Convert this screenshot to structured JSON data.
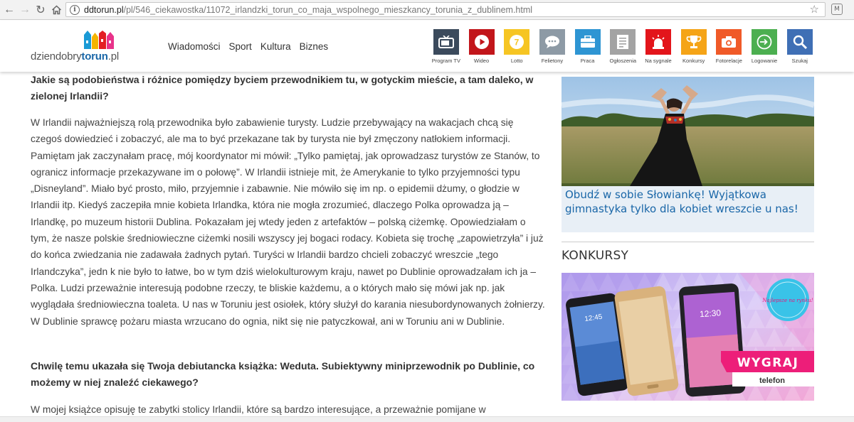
{
  "browser": {
    "url_host": "ddtorun.pl",
    "url_path": "/pl/546_ciekawostka/11072_irlandzki_torun_co_maja_wspolnego_mieszkancy_torunia_z_dublinem.html"
  },
  "header": {
    "logo_prefix": "dzien",
    "logo_mid": "dobry",
    "logo_bold": "torun",
    "logo_suffix": ".pl",
    "nav": [
      "Wiadomości",
      "Sport",
      "Kultura",
      "Biznes"
    ],
    "tiles": [
      {
        "label": "Program TV",
        "color": "#3b4a5c",
        "icon": "tv-icon"
      },
      {
        "label": "Wideo",
        "color": "#c2161b",
        "icon": "play-icon"
      },
      {
        "label": "Lotto",
        "color": "#f6c523",
        "icon": "lotto-ball-icon"
      },
      {
        "label": "Felietony",
        "color": "#8d9aa5",
        "icon": "speech-bubble-icon"
      },
      {
        "label": "Praca",
        "color": "#2e95d3",
        "icon": "briefcase-icon"
      },
      {
        "label": "Ogłoszenia",
        "color": "#a3a3a3",
        "icon": "document-icon"
      },
      {
        "label": "Na sygnale",
        "color": "#e3151b",
        "icon": "siren-icon"
      },
      {
        "label": "Konkursy",
        "color": "#f5a417",
        "icon": "trophy-icon"
      },
      {
        "label": "Fotorelacje",
        "color": "#f05a28",
        "icon": "camera-icon"
      },
      {
        "label": "Logowanie",
        "color": "#4caf50",
        "icon": "login-icon"
      },
      {
        "label": "Szukaj",
        "color": "#3f6fb5",
        "icon": "search-icon"
      }
    ],
    "lotto_number": "7"
  },
  "article": {
    "question1": "Jakie są podobieństwa i różnice pomiędzy byciem przewodnikiem tu, w gotyckim mieście, a tam daleko, w zielonej Irlandii?",
    "answer1": "W Irlandii najważniejszą rolą przewodnika było zabawienie turysty. Ludzie przebywający na wakacjach chcą się czegoś dowiedzieć i zobaczyć, ale ma to być przekazane tak by turysta nie był zmęczony natłokiem informacji. Pamiętam jak zaczynałam pracę, mój koordynator mi mówił: „Tylko pamiętaj, jak oprowadzasz turystów ze Stanów, to ogranicz informacje przekazywane im o połowę”. W Irlandii istnieje mit, że Amerykanie to tylko przyjemności typu „Disneyland”. Miało być prosto, miło, przyjemnie i zabawnie. Nie mówiło się im np. o epidemii dżumy, o głodzie w Irlandii itp. Kiedyś zaczepiła mnie kobieta Irlandka, która nie mogła zrozumieć, dlaczego Polka oprowadza ją – Irlandkę, po muzeum historii Dublina. Pokazałam jej wtedy jeden z artefaktów – polską ciżemkę. Opowiedziałam o tym, że nasze polskie średniowieczne ciżemki nosili wszyscy jej bogaci rodacy. Kobieta się trochę „zapowietrzyła” i już do końca zwiedzania nie zadawała żadnych pytań. Turyści w Irlandii bardzo chcieli zobaczyć wreszcie „tego Irlandczyka”, jedn k nie było to łatwe, bo w tym dziś wielokulturowym kraju, nawet po Dublinie oprowadzałam ich ja – Polka. Ludzi przeważnie interesują podobne rzeczy, te bliskie każdemu, a o których mało się mówi jak np. jak wyglądała średniowieczna toaleta. U nas w Toruniu jest osiołek, który służył do karania niesubordynowanych żołnierzy. W Dublinie sprawcę pożaru miasta wrzucano do ognia, nikt się nie patyczkował, ani w Toruniu ani w Dublinie.",
    "question2": "Chwilę temu ukazała się Twoja debiutancka książka: Weduta. Subiektywny miniprzewodnik po Dublinie, co możemy w niej znaleźć ciekawego?",
    "answer2": "W mojej książce opisuję te zabytki stolicy Irlandii, które są bardzo interesujące, a przeważnie pomijane w"
  },
  "sidebar": {
    "promo_title": "Obudź w sobie Słowiankę! Wyjątkowa gimnastyka tylko dla kobiet wreszcie u nas!",
    "konkursy_title": "KONKURSY",
    "banner_badge": "Najlepsze na rynku!",
    "banner_cta": "WYGRAJ",
    "banner_sub": "telefon",
    "phone_time1": "12:45",
    "phone_time2": "12:30"
  }
}
